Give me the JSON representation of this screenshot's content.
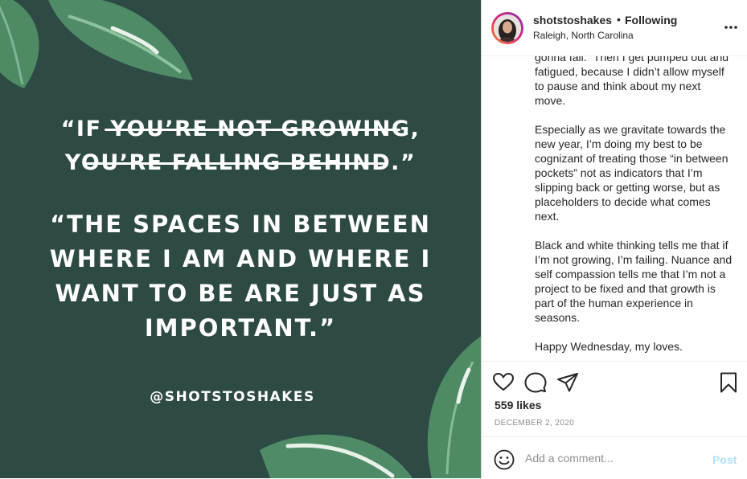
{
  "image": {
    "background_color": "#2d4a44",
    "struck_quote_lines": [
      "“IF YOU’RE NOT GROWING,",
      "YOU’RE FALLING BEHIND.”"
    ],
    "main_quote_lines": [
      "“THE SPACES IN BETWEEN",
      "WHERE I AM AND WHERE I",
      "WANT TO BE ARE JUST AS",
      "IMPORTANT.”"
    ],
    "handle": "@SHOTSTOSHAKES"
  },
  "header": {
    "username": "shotstoshakes",
    "separator": "•",
    "follow_status": "Following",
    "location": "Raleigh, North Carolina",
    "more_icon": "more-options-icon"
  },
  "caption": {
    "paragraphs": [
      "gonna fall.” Then I get pumped out and fatigued, because I didn’t allow myself to pause and think about my next move.",
      "Especially as we gravitate towards the new year, I’m doing my best to be cognizant of treating those “in between pockets” not as indicators that I’m slipping back or getting worse, but as placeholders to decide what comes next.",
      "Black and white thinking tells me that if I’m not growing, I’m failing. Nuance and self compassion tells me that I’m not a project to be fixed and that growth is part of the human experience in seasons.",
      "Happy Wednesday, my loves."
    ]
  },
  "actions": {
    "icons": [
      "heart-icon",
      "comment-icon",
      "share-icon",
      "bookmark-icon"
    ],
    "likes": "559 likes",
    "date": "DECEMBER 2, 2020"
  },
  "comment": {
    "placeholder": "Add a comment...",
    "post_label": "Post",
    "emoji_icon": "emoji-icon"
  },
  "colors": {
    "accent_ring": "#dd2a7b",
    "post_disabled": "#b2dffc",
    "text": "#262626",
    "muted": "#8e8e8e"
  }
}
